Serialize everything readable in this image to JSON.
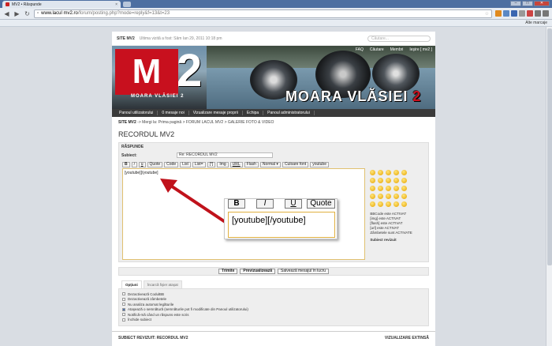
{
  "browser": {
    "tab_title": "MV2 • Răspunde",
    "url_host": "www.lacul mv2.ro",
    "url_path": "/forum/posting.php?mode=reply&f=13&t=23",
    "bookmarks_other": "Alte marcaje"
  },
  "forum": {
    "site_label": "SITE MV2",
    "last_visit": "Ultima vizită a fost: Sâm Ian 29, 2011 10:18 pm",
    "search_placeholder": "Căutare...",
    "top_nav": [
      "FAQ",
      "Căutare",
      "Membri",
      "Ieşire [ mv2 ]"
    ],
    "logo_sub": "MOARA VLĂSIEI 2",
    "banner_title_a": "MOARA VLĂSIEI ",
    "banner_title_b": "2",
    "main_nav": [
      "Panoul utilizatorului",
      "0 mesaje noi",
      "Vizualizare mesaje proprii",
      "Echipa",
      "Panoul administratorului"
    ],
    "breadcrumb_site": "SITE MV2",
    "breadcrumb_rest": " -> Mergi la: Prima pagină > FORUM LACUL MV2 > GALERIE FOTO & VIDEO",
    "page_title": "RECORDUL MV2"
  },
  "reply": {
    "header": "RĂSPUNDE",
    "subject_label": "Subiect:",
    "subject_value": "Re: RECORDUL MV2",
    "buttons": [
      "B",
      "i",
      "u",
      "Quote",
      "Code",
      "List",
      "List=",
      "[*]",
      "Img",
      "URL",
      "Flash",
      "Normal ▾",
      "Culoare font",
      "youtube"
    ],
    "message": "[youtube][/youtube]",
    "smilies_status": [
      "BBCode este ACTIVAT",
      "[img] este ACTIVAT",
      "[flash] este ACTIVAT",
      "[url] este ACTIVAT",
      "Zâmbetele sunt ACTIVATE"
    ],
    "topic_review": "Subiect revizuit",
    "submit": "Trimite",
    "preview": "Previzualizează",
    "save": "Salvează mesajul în lucru"
  },
  "zoom": {
    "buttons": [
      "B",
      "I",
      "U",
      "Quote"
    ],
    "text": "[youtube][/youtube]"
  },
  "options": {
    "tabs": [
      "Opţiuni",
      "Încarcă fişier ataşat"
    ],
    "items": [
      {
        "label": "Dezactivează CodulBB",
        "checked": false
      },
      {
        "label": "Dezactivează zâmbetele",
        "checked": false
      },
      {
        "label": "Nu analiza automat legăturile",
        "checked": false
      },
      {
        "label": "Ataşează o semnătură (semnăturile pot fi modificate din Panoul utilizatorului)",
        "checked": true
      },
      {
        "label": "Notifică-mă când un răspuns este scris",
        "checked": false
      },
      {
        "label": "Închide subiect",
        "checked": false
      }
    ]
  },
  "footer": {
    "left": "SUBIECT REVIZUIT: RECORDUL MV2",
    "right": "VIZUALIZARE EXTINSĂ"
  },
  "colors": {
    "accent": "#c8101e",
    "browser_frame": "#4d6fa1",
    "arrow": "#c0121b"
  }
}
